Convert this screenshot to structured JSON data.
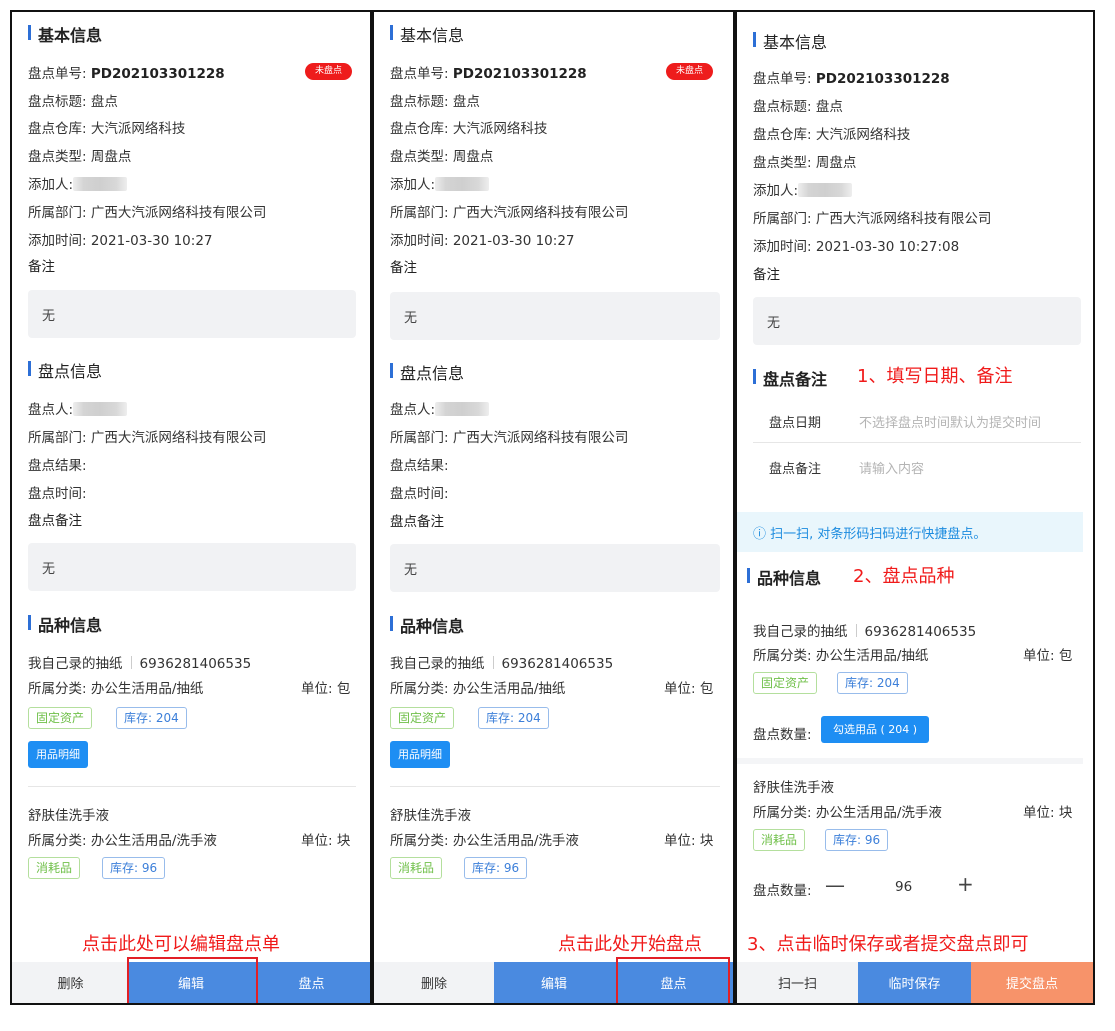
{
  "common": {
    "basic_title": "基本信息",
    "order_label": "盘点单号:",
    "order_no": "PD202103301228",
    "title_row": "盘点标题: 盘点",
    "warehouse_row": "盘点仓库: 大汽派网络科技",
    "type_row": "盘点类型: 周盘点",
    "adder_label": "添加人:",
    "dept_row": "所属部门: 广西大汽派网络科技有限公司",
    "remark_label": "备注",
    "remark_value": "无",
    "status_badge": "未盘点",
    "stock_info_title": "盘点信息",
    "checker_label": "盘点人:",
    "result_row": "盘点结果:",
    "time_row": "盘点时间:",
    "stock_remark_label": "盘点备注",
    "variety_title": "品种信息",
    "item1_name": "我自己录的抽纸",
    "item1_code": "6936281406535",
    "item1_category": "所属分类: 办公生活用品/抽纸",
    "item1_unit": "单位: 包",
    "tag_fixed": "固定资产",
    "item1_stock": "库存: 204",
    "detail_button": "用品明细",
    "item2_name": "舒肤佳洗手液",
    "item2_category": "所属分类: 办公生活用品/洗手液",
    "item2_unit": "单位: 块",
    "tag_consumable": "消耗品",
    "item2_stock": "库存: 96"
  },
  "panel1": {
    "add_time": "添加时间: 2021-03-30 10:27",
    "annotation": "点击此处可以编辑盘点单",
    "footer": [
      "删除",
      "编辑",
      "盘点"
    ]
  },
  "panel2": {
    "add_time": "添加时间: 2021-03-30 10:27",
    "annotation": "点击此处开始盘点",
    "footer": [
      "删除",
      "编辑",
      "盘点"
    ]
  },
  "panel3": {
    "add_time": "添加时间: 2021-03-30 10:27:08",
    "remark_section": "盘点备注",
    "annotation1": "1、填写日期、备注",
    "date_label": "盘点日期",
    "date_placeholder": "不选择盘点时间默认为提交时间",
    "remark_field_label": "盘点备注",
    "remark_placeholder": "请输入内容",
    "scan_tip": "ⓘ 扫一扫, 对条形码扫码进行快捷盘点。",
    "annotation2": "2、盘点品种",
    "qty_label": "盘点数量:",
    "select_button": "勾选用品 ( 204 )",
    "stepper_minus": "—",
    "stepper_value": "96",
    "stepper_plus": "+",
    "annotation3": "3、点击临时保存或者提交盘点即可",
    "footer": [
      "扫一扫",
      "临时保存",
      "提交盘点"
    ]
  }
}
